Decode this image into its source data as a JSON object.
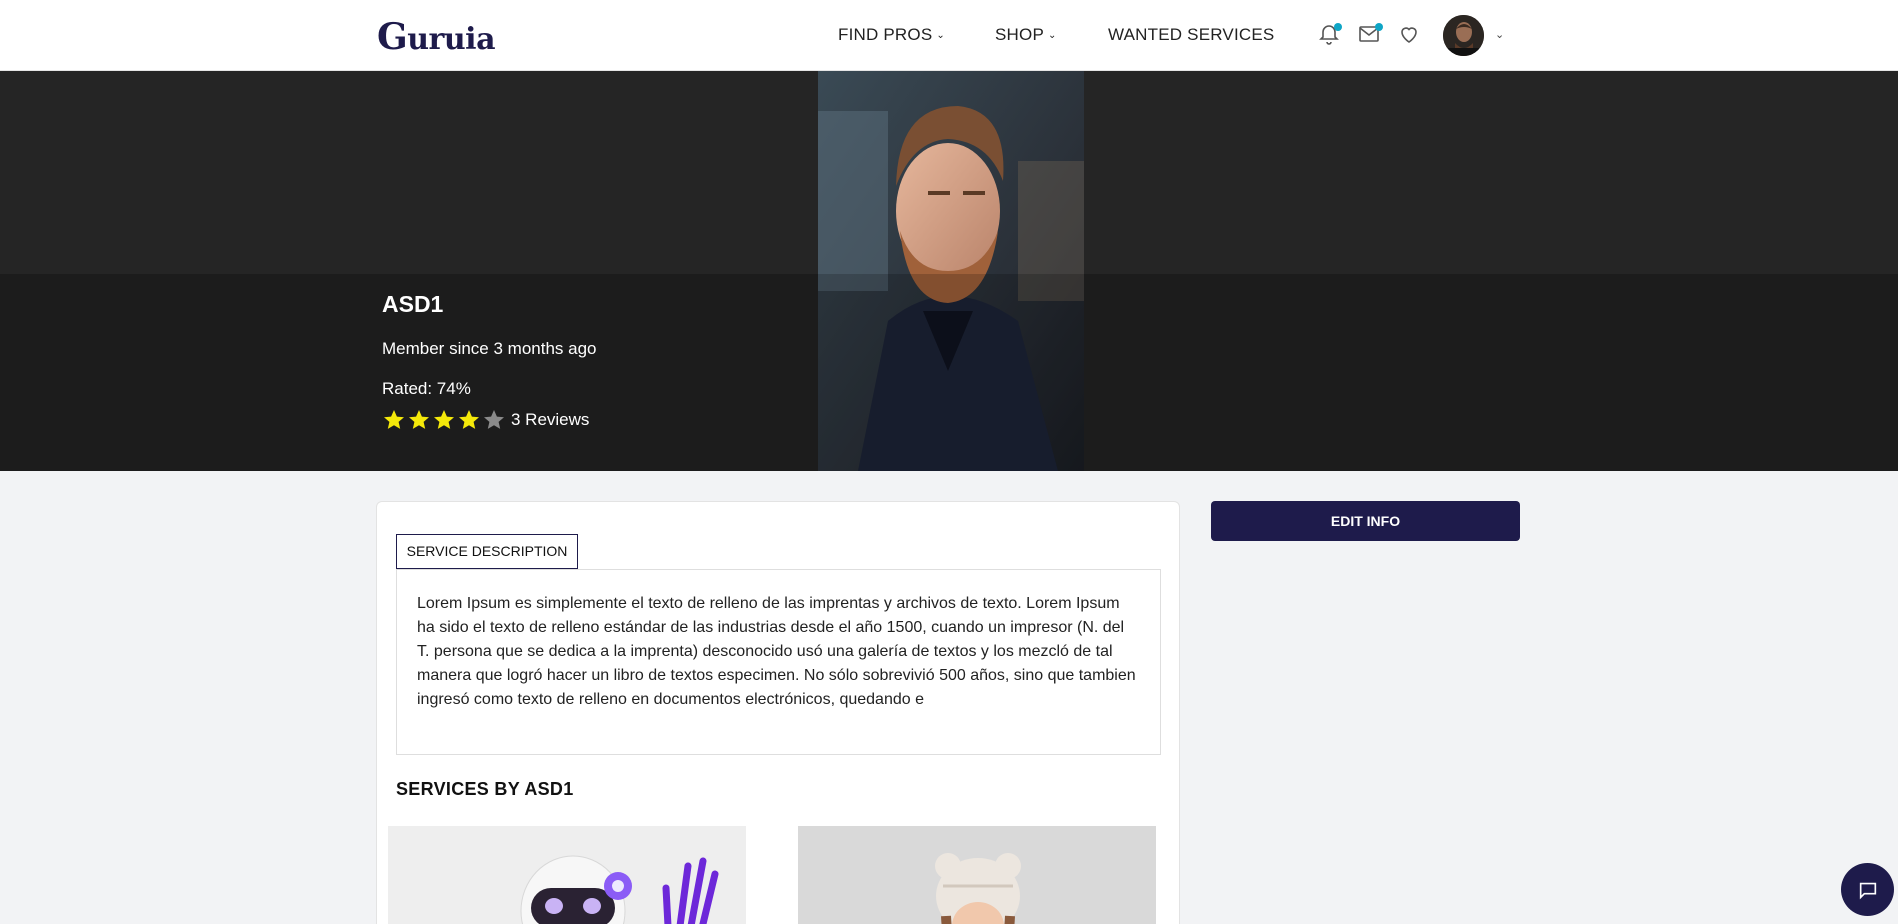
{
  "header": {
    "logo_first": "G",
    "logo_rest": "uruia",
    "nav": [
      {
        "label": "FIND PROS"
      },
      {
        "label": "SHOP"
      },
      {
        "label": "WANTED SERVICES"
      }
    ],
    "icons": [
      "bell-icon",
      "mail-icon",
      "heart-icon"
    ],
    "notification_dot_color": "#0ea5c6"
  },
  "profile": {
    "name": "ASD1",
    "member_since": "Member since 3 months ago",
    "rated": "Rated: 74%",
    "stars_filled": 4,
    "stars_total": 5,
    "reviews": "3 Reviews"
  },
  "tabs": {
    "service_description": "SERVICE DESCRIPTION"
  },
  "description": "Lorem Ipsum es simplemente el texto de relleno de las imprentas y archivos de texto. Lorem Ipsum ha sido el texto de relleno estándar de las industrias desde el año 1500, cuando un impresor (N. del T. persona que se dedica a la imprenta) desconocido usó una galería de textos y los mezcló de tal manera que logró hacer un libro de textos especimen. No sólo sobrevivió 500 años, sino que tambien ingresó como texto de relleno en documentos electrónicos, quedando e",
  "services": {
    "title": "SERVICES BY ASD1"
  },
  "actions": {
    "edit_info": "EDIT INFO"
  },
  "colors": {
    "brand": "#1e1b4b",
    "star_filled": "#f5e90a",
    "star_empty": "#8a8a8a",
    "hero_bg": "#252525"
  }
}
